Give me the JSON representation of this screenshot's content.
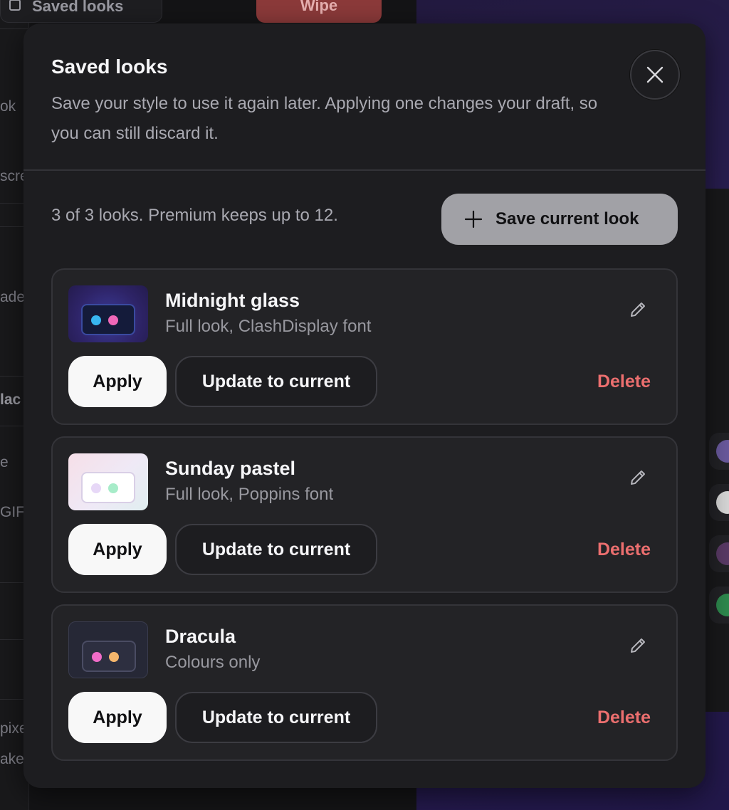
{
  "background": {
    "saved_looks_pill": "Saved looks",
    "wipe_button": "Wipe",
    "side_labels": [
      "ok",
      "scre",
      "ade",
      "lac",
      "e",
      "GIF",
      "pixe",
      "ake"
    ]
  },
  "modal": {
    "title": "Saved looks",
    "description": "Save your style to use it again later. Applying one changes your draft, so you can still discard it.",
    "close_icon": "close-icon",
    "count_text": "3 of 3 looks. Premium keeps up to 12.",
    "save_button_label": "Save current look",
    "looks": [
      {
        "name": "Midnight glass",
        "meta": "Full look, ClashDisplay font",
        "apply_label": "Apply",
        "update_label": "Update to current",
        "delete_label": "Delete",
        "thumb_colors": {
          "bg": "#3a2d74",
          "screen": "#141b3a",
          "border": "#3a4aa0",
          "dot1": "#38b6f0",
          "dot2": "#f067b8"
        }
      },
      {
        "name": "Sunday pastel",
        "meta": "Full look, Poppins font",
        "apply_label": "Apply",
        "update_label": "Update to current",
        "delete_label": "Delete",
        "thumb_colors": {
          "bg": "#f0e4ee",
          "screen": "#ffffff",
          "border": "#d9cfe6",
          "dot1": "#e7d8f7",
          "dot2": "#a7ecc9"
        }
      },
      {
        "name": "Dracula",
        "meta": "Colours only",
        "apply_label": "Apply",
        "update_label": "Update to current",
        "delete_label": "Delete",
        "thumb_colors": {
          "bg": "#262836",
          "screen": "#2d2f40",
          "border": "#4a4c63",
          "dot1": "#f06cc8",
          "dot2": "#f5b66c"
        }
      }
    ]
  },
  "colors": {
    "delete": "#ec6f6f",
    "modal_bg": "#1d1d20",
    "card_bg": "#232326"
  }
}
